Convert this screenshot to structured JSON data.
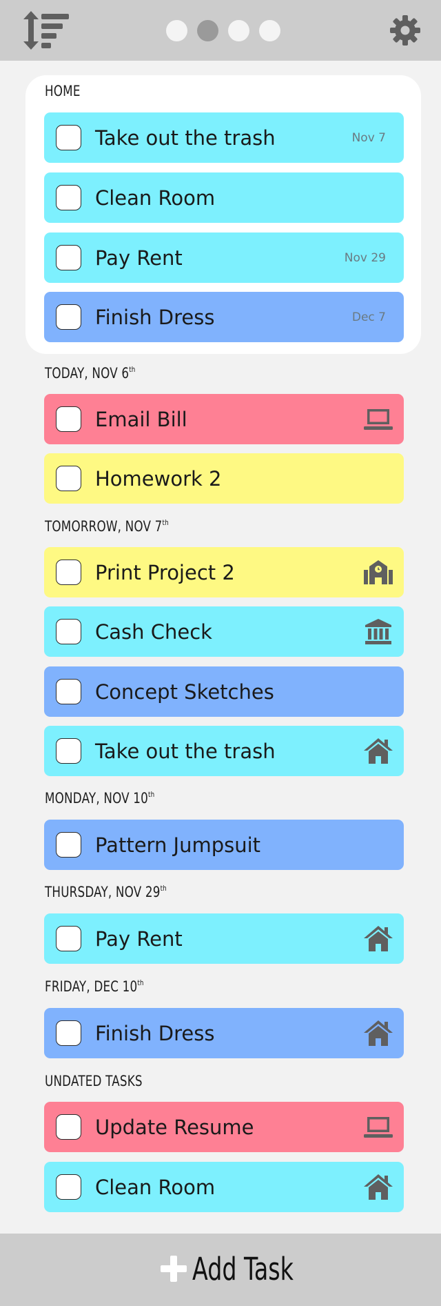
{
  "header": {
    "sort_icon": "sort-icon",
    "settings_icon": "gear-icon",
    "page_dots": [
      false,
      true,
      false,
      false
    ]
  },
  "home": {
    "title": "HOME",
    "tasks": [
      {
        "label": "Take out the trash",
        "date": "Nov 7",
        "color": "#7df0fe"
      },
      {
        "label": "Clean Room",
        "date": "",
        "color": "#7df0fe"
      },
      {
        "label": "Pay Rent",
        "date": "Nov 29",
        "color": "#7df0fe"
      },
      {
        "label": "Finish Dress",
        "date": "Dec 7",
        "color": "#80b2fd"
      }
    ]
  },
  "sections": [
    {
      "title": "TODAY, NOV 6",
      "suffix": "th",
      "tasks": [
        {
          "label": "Email Bill",
          "icon": "laptop-icon",
          "color": "#fe8094"
        },
        {
          "label": "Homework 2",
          "icon": "",
          "color": "#fef983"
        }
      ]
    },
    {
      "title": "TOMORROW, NOV 7",
      "suffix": "th",
      "tasks": [
        {
          "label": "Print Project 2",
          "icon": "school-icon",
          "color": "#fef983"
        },
        {
          "label": "Cash Check",
          "icon": "bank-icon",
          "color": "#7df0fe"
        },
        {
          "label": "Concept Sketches",
          "icon": "",
          "color": "#80b2fd"
        },
        {
          "label": "Take out the trash",
          "icon": "home-icon",
          "color": "#7df0fe"
        }
      ]
    },
    {
      "title": "MONDAY, NOV 10",
      "suffix": "th",
      "tasks": [
        {
          "label": "Pattern Jumpsuit",
          "icon": "",
          "color": "#80b2fd"
        }
      ]
    },
    {
      "title": "THURSDAY, NOV 29",
      "suffix": "th",
      "tasks": [
        {
          "label": "Pay Rent",
          "icon": "home-icon",
          "color": "#7df0fe"
        }
      ]
    },
    {
      "title": "FRIDAY, DEC 10",
      "suffix": "th",
      "tasks": [
        {
          "label": "Finish Dress",
          "icon": "home-icon",
          "color": "#80b2fd"
        }
      ]
    },
    {
      "title": "UNDATED TASKS",
      "suffix": "",
      "tasks": [
        {
          "label": "Update Resume",
          "icon": "laptop-icon",
          "color": "#fe8094"
        },
        {
          "label": "Clean Room",
          "icon": "home-icon",
          "color": "#7df0fe"
        }
      ]
    }
  ],
  "footer": {
    "add_label": "Add Task",
    "add_icon": "plus-icon"
  },
  "colors": {
    "bar": "#cccccc",
    "background": "#f2f2f2",
    "cyan": "#7df0fe",
    "blue": "#80b2fd",
    "pink": "#fe8094",
    "yellow": "#fef983",
    "icon": "#5f5f5f"
  }
}
